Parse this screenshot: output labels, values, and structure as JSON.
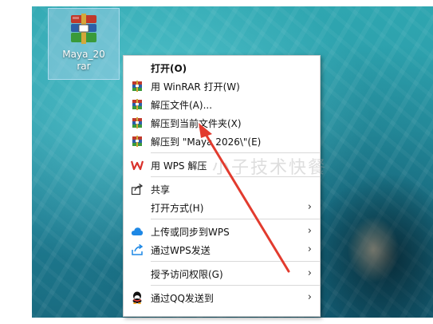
{
  "desktop": {
    "icon_label_line1": "Maya_20",
    "icon_label_line2": "rar",
    "icon": "winrar-archive-icon"
  },
  "menu": {
    "items": [
      {
        "label": "打开(O)",
        "icon": "none",
        "bold": true,
        "arrow": false
      },
      {
        "label": "用 WinRAR 打开(W)",
        "icon": "winrar-icon",
        "arrow": false
      },
      {
        "label": "解压文件(A)...",
        "icon": "winrar-icon",
        "arrow": false
      },
      {
        "label": "解压到当前文件夹(X)",
        "icon": "winrar-icon",
        "arrow": false
      },
      {
        "label": "解压到 \"Maya 2026\\\"(E)",
        "icon": "winrar-icon",
        "arrow": false
      },
      {
        "label": "用 WPS 解压",
        "icon": "wps-icon",
        "arrow": false
      },
      {
        "label": "共享",
        "icon": "share-icon",
        "arrow": false
      },
      {
        "label": "打开方式(H)",
        "icon": "none",
        "arrow": true
      },
      {
        "label": "上传或同步到WPS",
        "icon": "cloud-icon",
        "arrow": true
      },
      {
        "label": "通过WPS发送",
        "icon": "send-icon",
        "arrow": true
      },
      {
        "label": "授予访问权限(G)",
        "icon": "none",
        "arrow": true
      },
      {
        "label": "通过QQ发送到",
        "icon": "qq-icon",
        "arrow": true
      }
    ],
    "arrow_glyph": "›"
  },
  "watermark": "小子技术快餐",
  "colors": {
    "winrar_red": "#c0392b",
    "winrar_blue": "#2c5fa8",
    "winrar_green": "#3a9a3a",
    "wps_red": "#d9312b",
    "cloud_blue": "#1e88e5",
    "annotation_arrow": "#e23b2e"
  }
}
